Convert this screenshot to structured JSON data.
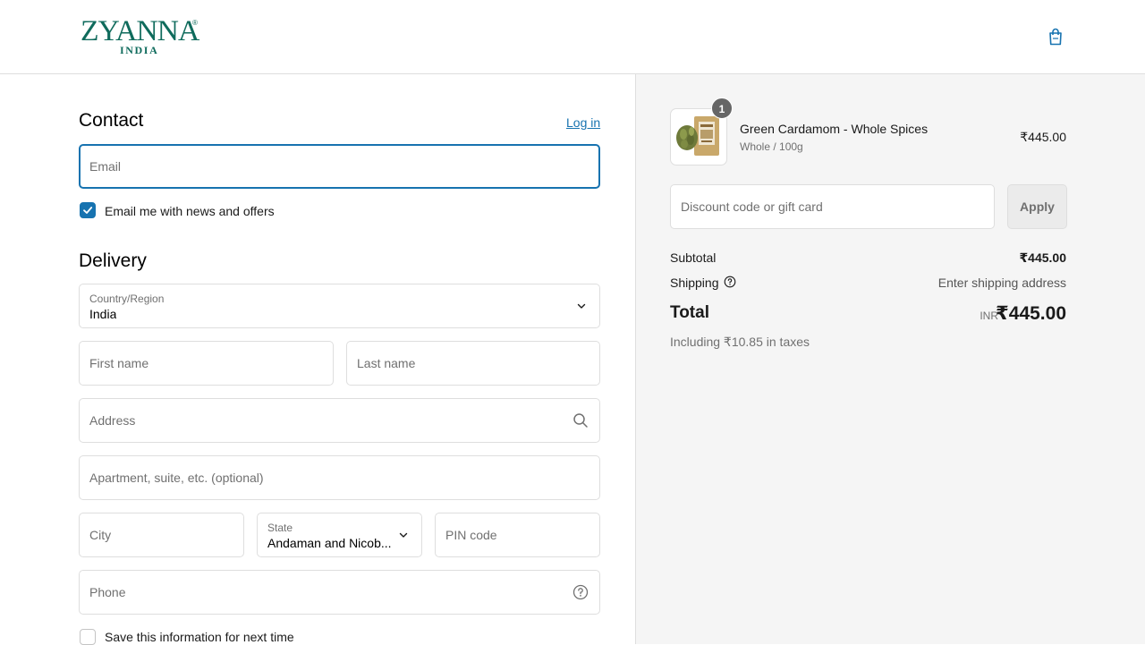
{
  "header": {
    "logo_text": "ZYANNA",
    "logo_sub": "INDIA",
    "logo_mark": "®"
  },
  "contact": {
    "title": "Contact",
    "login_link": "Log in",
    "email_placeholder": "Email",
    "news_checkbox_label": "Email me with news and offers",
    "news_checked": true
  },
  "delivery": {
    "title": "Delivery",
    "country_label": "Country/Region",
    "country_value": "India",
    "first_name_placeholder": "First name",
    "last_name_placeholder": "Last name",
    "address_placeholder": "Address",
    "apartment_placeholder": "Apartment, suite, etc. (optional)",
    "city_placeholder": "City",
    "state_label": "State",
    "state_value": "Andaman and Nicob...",
    "pin_placeholder": "PIN code",
    "phone_placeholder": "Phone",
    "save_info_label": "Save this information for next time",
    "save_info_checked": false
  },
  "summary": {
    "product": {
      "name": "Green Cardamom - Whole Spices",
      "variant": "Whole / 100g",
      "price": "₹445.00",
      "quantity": "1"
    },
    "discount_placeholder": "Discount code or gift card",
    "apply_label": "Apply",
    "subtotal_label": "Subtotal",
    "subtotal_value": "₹445.00",
    "shipping_label": "Shipping",
    "shipping_value": "Enter shipping address",
    "total_label": "Total",
    "total_currency": "INR",
    "total_value": "₹445.00",
    "taxes_note": "Including ₹10.85 in taxes"
  },
  "colors": {
    "brand": "#0f6b5c",
    "accent": "#1773b0",
    "summary_bg": "#f5f5f5"
  }
}
